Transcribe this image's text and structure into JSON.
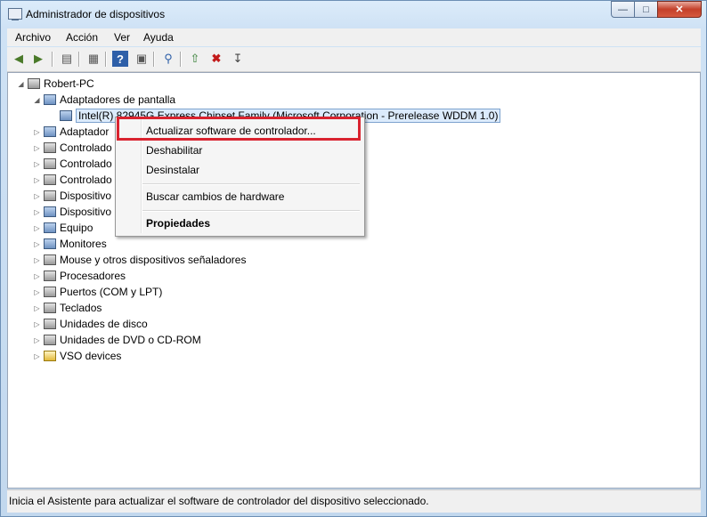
{
  "window": {
    "title": "Administrador de dispositivos"
  },
  "menu": [
    "Archivo",
    "Acción",
    "Ver",
    "Ayuda"
  ],
  "toolbar": {
    "icons": [
      "back-arrow-icon",
      "forward-arrow-icon",
      "show-hide-console-tree-icon",
      "properties-icon",
      "help-icon",
      "view-icon",
      "scan-hardware-icon",
      "update-driver-icon",
      "uninstall-icon",
      "disable-icon"
    ]
  },
  "tree": {
    "root": "Robert-PC",
    "expanded_category": "Adaptadores de pantalla",
    "selected_device": "Intel(R) 82945G Express Chipset Family (Microsoft Corporation - Prerelease WDDM 1.0)",
    "categories": [
      "Adaptadores de red",
      "Controladoras ATA/ATAPI IDE",
      "Controladoras de bus serie universal",
      "Controladoras de sonido y vídeo y dispositivos de juego",
      "Dispositivos de interfaz de usuario (HID)",
      "Dispositivos del sistema",
      "Equipo",
      "Monitores",
      "Mouse y otros dispositivos señaladores",
      "Procesadores",
      "Puertos (COM y LPT)",
      "Teclados",
      "Unidades de disco",
      "Unidades de DVD o CD-ROM",
      "VSO devices"
    ],
    "truncated_labels": [
      "Adaptador",
      "Controlado",
      "Controlado",
      "Controlado",
      "Dispositivo",
      "Dispositivo"
    ]
  },
  "context_menu": {
    "update_driver": "Actualizar software de controlador...",
    "disable": "Deshabilitar",
    "uninstall": "Desinstalar",
    "scan": "Buscar cambios de hardware",
    "properties": "Propiedades"
  },
  "status": "Inicia el Asistente para actualizar el software de controlador del dispositivo seleccionado.",
  "colors": {
    "highlight": "#d9232f",
    "selection": "#dcebfc"
  }
}
